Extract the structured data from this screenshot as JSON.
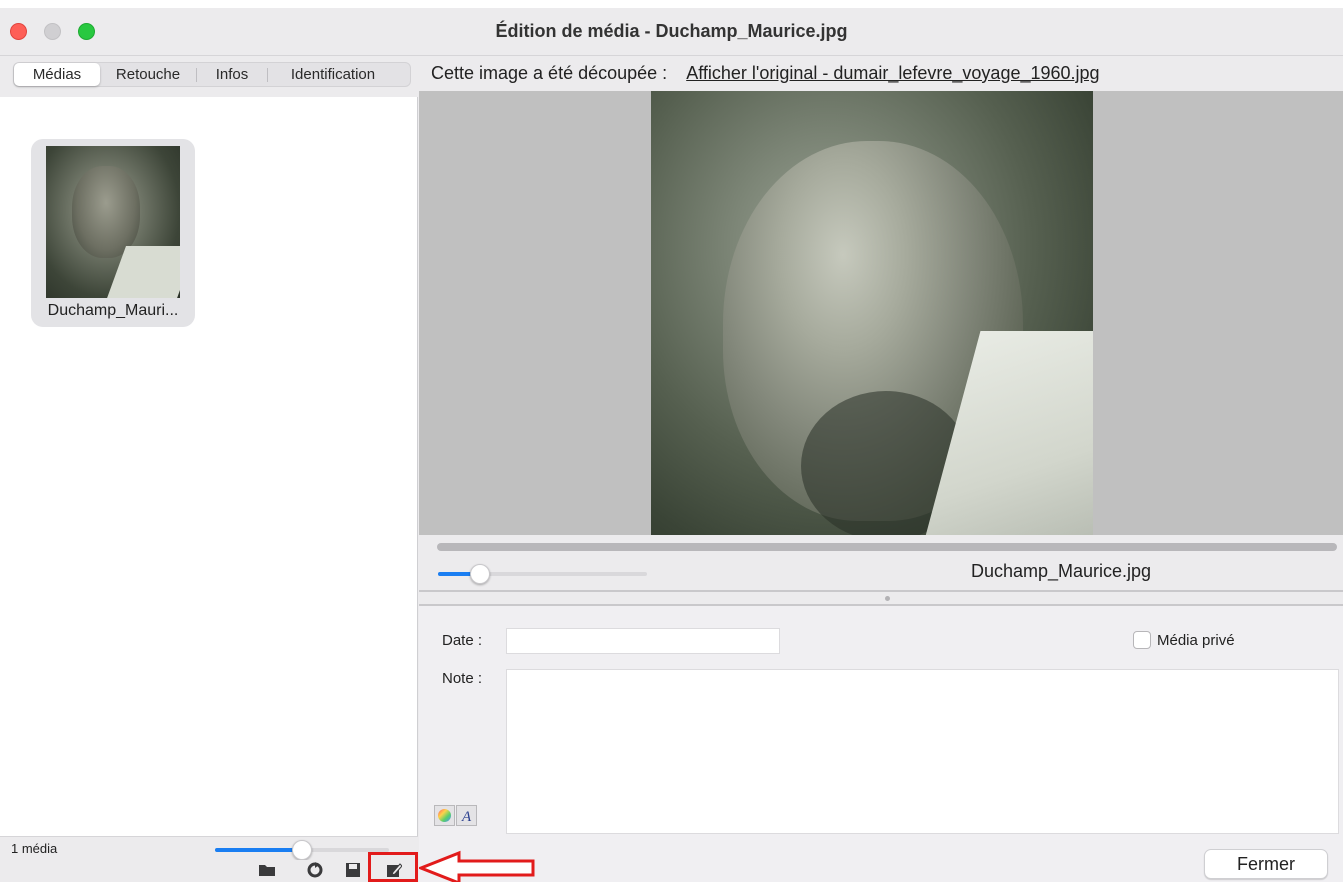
{
  "window": {
    "title": "Édition de média - Duchamp_Maurice.jpg"
  },
  "tabs": [
    {
      "label": "Médias",
      "active": true
    },
    {
      "label": "Retouche",
      "active": false
    },
    {
      "label": "Infos",
      "active": false
    },
    {
      "label": "Identification",
      "active": false
    }
  ],
  "media_list": {
    "items": [
      {
        "label": "Duchamp_Mauri..."
      }
    ],
    "status": "1 média",
    "thumb_size_level": 0.5
  },
  "toolbar": {
    "icons": [
      "folder-icon",
      "refresh-icon",
      "save-icon",
      "edit-icon"
    ]
  },
  "crop_notice": {
    "text": "Cette image a été découpée :",
    "link": "Afficher l'original - dumair_lefevre_voyage_1960.jpg"
  },
  "viewer": {
    "file_name": "Duchamp_Maurice.jpg",
    "zoom_level": 0.2
  },
  "form": {
    "date_label": "Date :",
    "date_value": "",
    "private_label": "Média privé",
    "private_checked": false,
    "note_label": "Note :",
    "note_value": "",
    "close_label": "Fermer"
  },
  "colors": {
    "accent": "#1a7ef2",
    "annotation": "#e21b1b"
  }
}
